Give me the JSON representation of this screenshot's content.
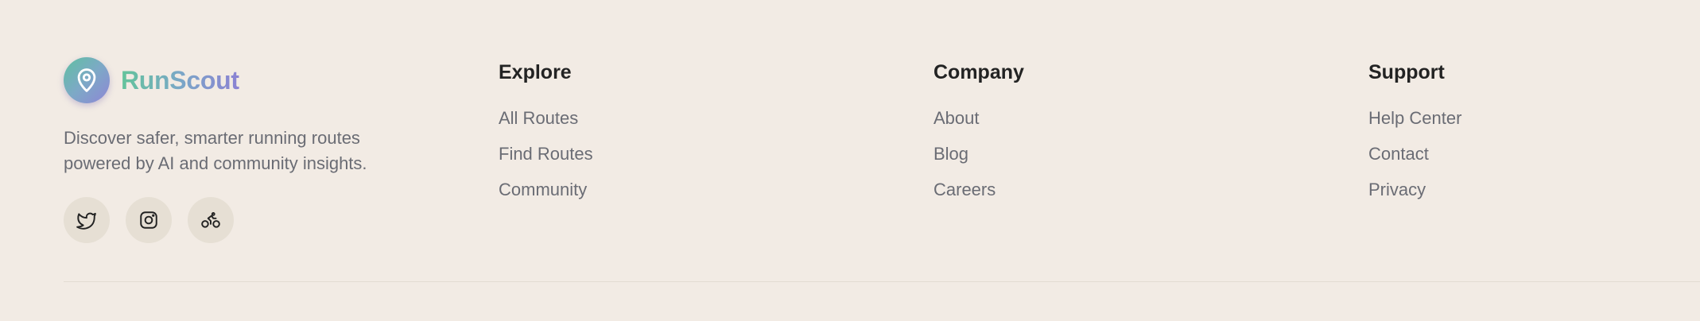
{
  "brand": {
    "name": "RunScout",
    "tagline": "Discover safer, smarter running routes powered by AI and community insights.",
    "logo_icon": "map-pin-icon",
    "colors": {
      "gradient_start": "#5fc0a1",
      "gradient_end": "#8e86d6",
      "background": "#f2ebe4"
    }
  },
  "socials": [
    {
      "icon": "twitter-icon"
    },
    {
      "icon": "instagram-icon"
    },
    {
      "icon": "bike-icon"
    }
  ],
  "columns": {
    "explore": {
      "title": "Explore",
      "links": [
        "All Routes",
        "Find Routes",
        "Community"
      ]
    },
    "company": {
      "title": "Company",
      "links": [
        "About",
        "Blog",
        "Careers"
      ]
    },
    "support": {
      "title": "Support",
      "links": [
        "Help Center",
        "Contact",
        "Privacy"
      ]
    }
  }
}
